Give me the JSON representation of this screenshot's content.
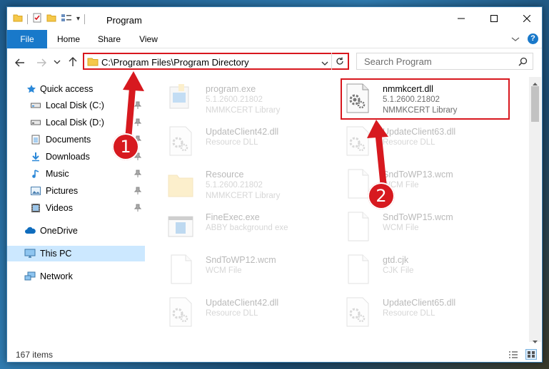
{
  "window": {
    "title": "Program",
    "qat_dropdown": "▾"
  },
  "ribbon": {
    "tabs": [
      {
        "label": "File"
      },
      {
        "label": "Home"
      },
      {
        "label": "Share"
      },
      {
        "label": "View"
      }
    ]
  },
  "address": {
    "path": "C:\\Program Files\\Program Directory"
  },
  "search": {
    "placeholder": "Search Program"
  },
  "sidebar": {
    "items": [
      {
        "label": "Quick access",
        "icon": "star-icon"
      },
      {
        "label": "Local Disk (C:)",
        "icon": "drive-icon",
        "pinned": true
      },
      {
        "label": "Local Disk (D:)",
        "icon": "drive-icon",
        "pinned": true
      },
      {
        "label": "Documents",
        "icon": "documents-icon",
        "pinned": true
      },
      {
        "label": "Downloads",
        "icon": "download-icon",
        "pinned": true
      },
      {
        "label": "Music",
        "icon": "music-icon",
        "pinned": true
      },
      {
        "label": "Pictures",
        "icon": "pictures-icon",
        "pinned": true
      },
      {
        "label": "Videos",
        "icon": "videos-icon",
        "pinned": true
      },
      {
        "label": "OneDrive",
        "icon": "cloud-icon"
      },
      {
        "label": "This PC",
        "icon": "computer-icon",
        "selected": true
      },
      {
        "label": "Network",
        "icon": "network-icon"
      }
    ]
  },
  "files": [
    {
      "name": "program.exe",
      "line1": "5.1.2600.21802",
      "line2": "NMMKCERT Library",
      "icon": "exe-icon"
    },
    {
      "name": "nmmkcert.dll",
      "line1": "5.1.2600.21802",
      "line2": "NMMKCERT Library",
      "icon": "dll-gear-icon"
    },
    {
      "name": "UpdateClient42.dll",
      "line1": "Resource DLL",
      "line2": "",
      "icon": "dll-gear-icon"
    },
    {
      "name": "UpdateClient63.dll",
      "line1": "Resource DLL",
      "line2": "",
      "icon": "dll-gear-icon"
    },
    {
      "name": "Resource",
      "line1": "5.1.2600.21802",
      "line2": "NMMKCERT Library",
      "icon": "folder-icon"
    },
    {
      "name": "SndToWP13.wcm",
      "line1": "WCM File",
      "line2": "",
      "icon": "blank-file-icon"
    },
    {
      "name": "FineExec.exe",
      "line1": "ABBY background exe",
      "line2": "",
      "icon": "app-window-icon"
    },
    {
      "name": "SndToWP15.wcm",
      "line1": "WCM File",
      "line2": "",
      "icon": "blank-file-icon"
    },
    {
      "name": "SndToWP12.wcm",
      "line1": "WCM File",
      "line2": "",
      "icon": "blank-file-icon"
    },
    {
      "name": "gtd.cjk",
      "line1": "CJK File",
      "line2": "",
      "icon": "blank-file-icon"
    },
    {
      "name": "UpdateClient42.dll",
      "line1": "Resource DLL",
      "line2": "",
      "icon": "dll-gear-icon"
    },
    {
      "name": "UpdateClient65.dll",
      "line1": "Resource DLL",
      "line2": "",
      "icon": "dll-gear-icon"
    }
  ],
  "status": {
    "item_count": "167 items"
  },
  "callouts": {
    "one": "1",
    "two": "2"
  },
  "colors": {
    "accent": "#1979ca",
    "highlight": "#d8171e",
    "selected_bg": "#cce8ff"
  }
}
